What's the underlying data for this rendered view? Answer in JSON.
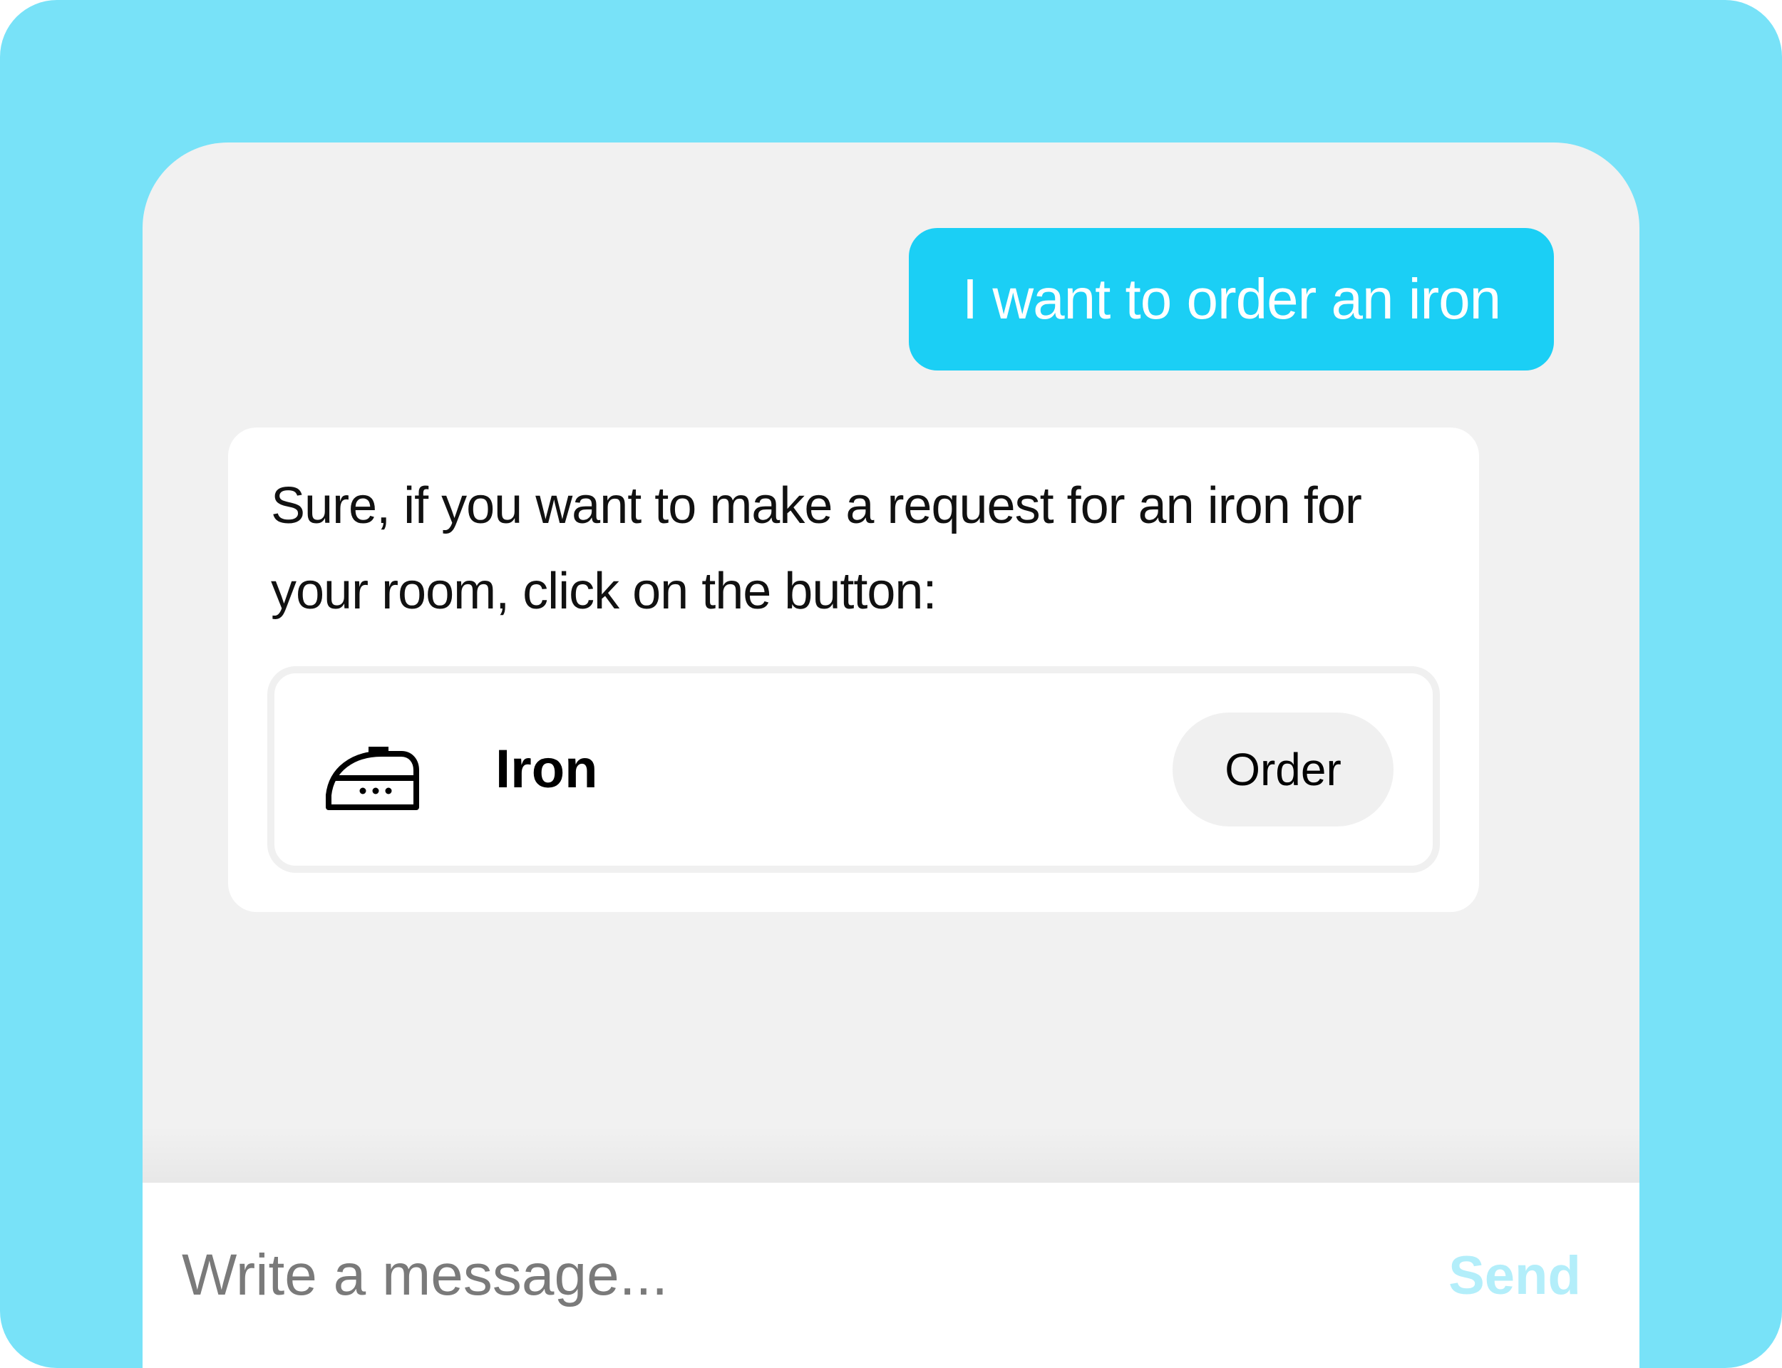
{
  "colors": {
    "background": "#78e2f8",
    "chat_area": "#f1f1f1",
    "user_bubble": "#1bcff5",
    "send_disabled": "#b3eefa"
  },
  "conversation": {
    "user_message": "I want to order an iron",
    "bot_message": "Sure, if you want to make a request for an iron for your room, click on the button:",
    "item_card": {
      "icon": "iron-icon",
      "label": "Iron",
      "action_label": "Order"
    }
  },
  "composer": {
    "placeholder": "Write a message...",
    "send_label": "Send"
  }
}
